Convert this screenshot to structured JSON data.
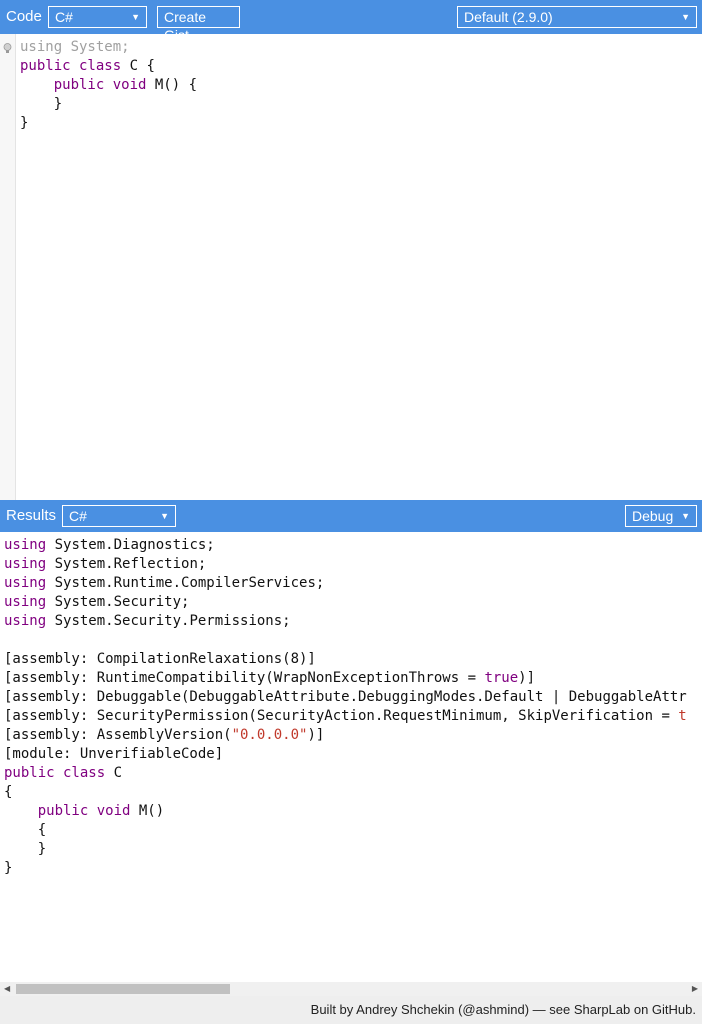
{
  "code_bar": {
    "title": "Code",
    "language": "C#",
    "create_gist": "Create Gist",
    "branch": "Default (2.9.0)"
  },
  "editor": {
    "lines": [
      [
        {
          "t": "using System;",
          "c": "dim"
        }
      ],
      [
        {
          "t": "public class",
          "c": "kw"
        },
        {
          "t": " C {",
          "c": ""
        }
      ],
      [
        {
          "t": "    public void",
          "c": "kw"
        },
        {
          "t": " M() {",
          "c": ""
        }
      ],
      [
        {
          "t": "    }",
          "c": ""
        }
      ],
      [
        {
          "t": "}",
          "c": ""
        }
      ]
    ]
  },
  "results_bar": {
    "title": "Results",
    "language": "C#",
    "mode": "Debug"
  },
  "results": {
    "lines": [
      [
        {
          "t": "using",
          "c": "kw"
        },
        {
          "t": " System.Diagnostics;",
          "c": ""
        }
      ],
      [
        {
          "t": "using",
          "c": "kw"
        },
        {
          "t": " System.Reflection;",
          "c": ""
        }
      ],
      [
        {
          "t": "using",
          "c": "kw"
        },
        {
          "t": " System.Runtime.CompilerServices;",
          "c": ""
        }
      ],
      [
        {
          "t": "using",
          "c": "kw"
        },
        {
          "t": " System.Security;",
          "c": ""
        }
      ],
      [
        {
          "t": "using",
          "c": "kw"
        },
        {
          "t": " System.Security.Permissions;",
          "c": ""
        }
      ],
      [
        {
          "t": "",
          "c": ""
        }
      ],
      [
        {
          "t": "[assembly: CompilationRelaxations(8)]",
          "c": ""
        }
      ],
      [
        {
          "t": "[assembly: RuntimeCompatibility(WrapNonExceptionThrows = ",
          "c": ""
        },
        {
          "t": "true",
          "c": "kw"
        },
        {
          "t": ")]",
          "c": ""
        }
      ],
      [
        {
          "t": "[assembly: Debuggable(DebuggableAttribute.DebuggingModes.Default | DebuggableAttr",
          "c": ""
        }
      ],
      [
        {
          "t": "[assembly: SecurityPermission(SecurityAction.RequestMinimum, SkipVerification = ",
          "c": ""
        },
        {
          "t": "t",
          "c": "str"
        }
      ],
      [
        {
          "t": "[assembly: AssemblyVersion(",
          "c": ""
        },
        {
          "t": "\"0.0.0.0\"",
          "c": "str"
        },
        {
          "t": ")]",
          "c": ""
        }
      ],
      [
        {
          "t": "[module: UnverifiableCode]",
          "c": ""
        }
      ],
      [
        {
          "t": "public class",
          "c": "kw"
        },
        {
          "t": " C",
          "c": ""
        }
      ],
      [
        {
          "t": "{",
          "c": ""
        }
      ],
      [
        {
          "t": "    public void",
          "c": "kw"
        },
        {
          "t": " M()",
          "c": ""
        }
      ],
      [
        {
          "t": "    {",
          "c": ""
        }
      ],
      [
        {
          "t": "    }",
          "c": ""
        }
      ],
      [
        {
          "t": "}",
          "c": ""
        }
      ]
    ]
  },
  "footer": {
    "text": "Built by Andrey Shchekin (@ashmind) — see SharpLab on GitHub."
  },
  "icons": {
    "lightbulb": "lightbulb-icon",
    "dropdown": "chevron-down-icon",
    "scroll_left": "scroll-left-arrow-icon",
    "scroll_right": "scroll-right-arrow-icon"
  },
  "colors": {
    "bar": "#4a90e2",
    "keyword": "#800080",
    "string": "#c0392b"
  }
}
